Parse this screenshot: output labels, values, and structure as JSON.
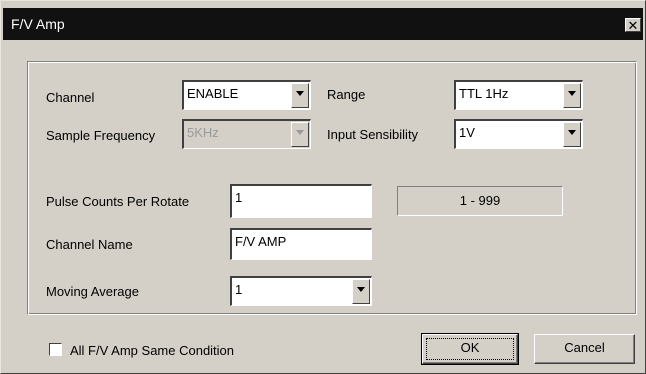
{
  "window": {
    "title": "F/V Amp",
    "close_glyph": "✕"
  },
  "form": {
    "channel": {
      "label": "Channel",
      "value": "ENABLE"
    },
    "range": {
      "label": "Range",
      "value": "TTL 1Hz"
    },
    "sample_frequency": {
      "label": "Sample Frequency",
      "value": "5KHz",
      "disabled": true
    },
    "input_sensibility": {
      "label": "Input Sensibility",
      "value": "1V"
    },
    "pulse_counts": {
      "label": "Pulse Counts Per Rotate",
      "value": "1",
      "range_hint": "1 - 999"
    },
    "channel_name": {
      "label": "Channel Name",
      "value": "F/V AMP"
    },
    "moving_average": {
      "label": "Moving Average",
      "value": "1"
    }
  },
  "footer": {
    "same_condition_label": "All F/V Amp Same Condition",
    "same_condition_checked": false,
    "ok_label": "OK",
    "cancel_label": "Cancel"
  },
  "icons": {
    "close": "close-icon",
    "dropdown": "chevron-down-icon"
  }
}
